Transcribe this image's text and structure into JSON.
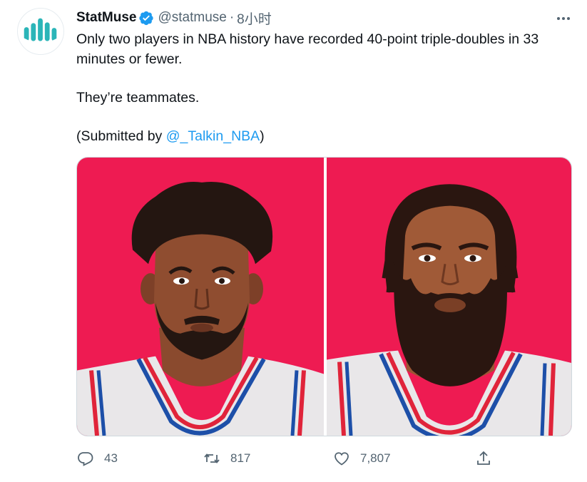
{
  "tweet": {
    "display_name": "StatMuse",
    "handle": "@statmuse",
    "separator": "·",
    "time": "8小时",
    "text_line1": "Only two players in NBA history have recorded 40-point triple-doubles in 33 minutes or fewer.",
    "text_line2": "They’re teammates.",
    "text_line3_prefix": "(Submitted by ",
    "mention": "@_Talkin_NBA",
    "text_line3_suffix": ")"
  },
  "media": {
    "background_color": "#ee1b52",
    "jersey_color": "#e9e7e9",
    "trim_red": "#e0243a",
    "trim_blue": "#1d4fa8"
  },
  "actions": {
    "reply_count": "43",
    "retweet_count": "817",
    "like_count": "7,807"
  },
  "icons": [
    "statmuse-logo-icon",
    "verified-badge-icon",
    "more-options-icon",
    "reply-icon",
    "retweet-icon",
    "like-icon",
    "share-icon"
  ],
  "colors": {
    "accent": "#1d9bf0",
    "secondary_text": "#536471",
    "logo_teal": "#2bb5b8"
  }
}
